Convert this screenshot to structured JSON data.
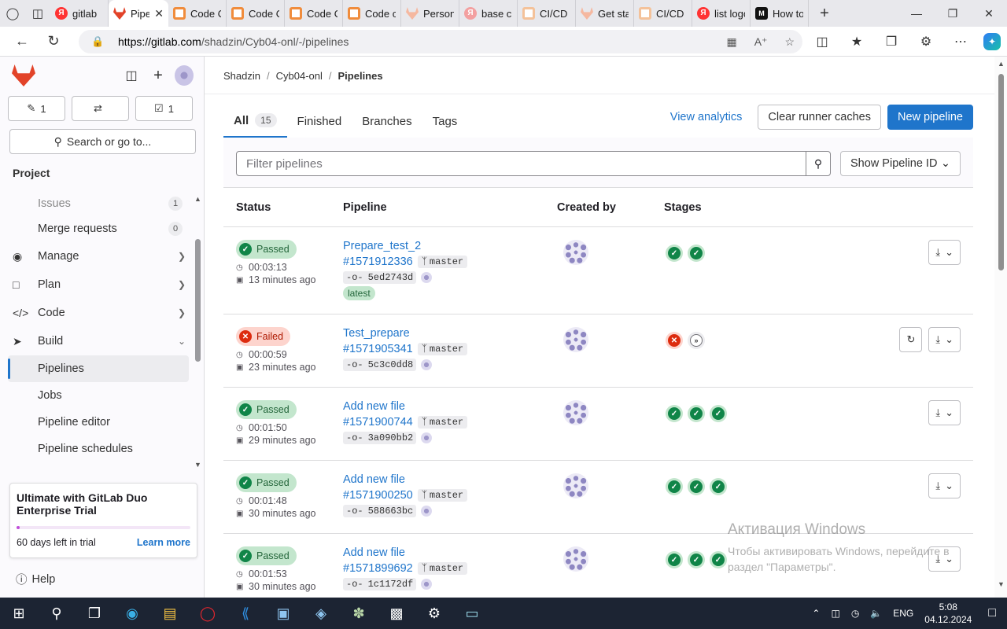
{
  "browser": {
    "tabs": [
      {
        "title": "gitlab",
        "icon": "yandex-icon"
      },
      {
        "title": "Pipelines",
        "icon": "gitlab-icon",
        "active": true
      },
      {
        "title": "Code O",
        "icon": "coursera-icon"
      },
      {
        "title": "Code O",
        "icon": "coursera-icon"
      },
      {
        "title": "Code O",
        "icon": "coursera-icon"
      },
      {
        "title": "Code co",
        "icon": "coursera-icon"
      },
      {
        "title": "Persona",
        "icon": "gitlab-icon"
      },
      {
        "title": "base ci",
        "icon": "yandex-icon"
      },
      {
        "title": "CI/CD Y",
        "icon": "coursera-icon"
      },
      {
        "title": "Get star",
        "icon": "gitlab-icon"
      },
      {
        "title": "CI/CD Y",
        "icon": "coursera-icon"
      },
      {
        "title": "list logo",
        "icon": "yandex-icon"
      },
      {
        "title": "How to",
        "icon": "medium-icon"
      }
    ],
    "url_host": "https://gitlab.com",
    "url_path": "/shadzin/Cyb04-onl/-/pipelines"
  },
  "sidebar": {
    "counts": {
      "issues": "1",
      "merge_requests": "",
      "todos": "1"
    },
    "search_label": "Search or go to...",
    "section_title": "Project",
    "items": [
      {
        "label": "Issues",
        "badge": "1"
      },
      {
        "label": "Merge requests",
        "badge": "0"
      },
      {
        "label": "Manage"
      },
      {
        "label": "Plan"
      },
      {
        "label": "Code"
      },
      {
        "label": "Build"
      },
      {
        "label": "Pipelines"
      },
      {
        "label": "Jobs"
      },
      {
        "label": "Pipeline editor"
      },
      {
        "label": "Pipeline schedules"
      }
    ],
    "trial": {
      "title": "Ultimate with GitLab Duo Enterprise Trial",
      "days_left": "60 days left in trial",
      "progress": 0.02,
      "learn_more": "Learn more"
    },
    "help_label": "Help"
  },
  "breadcrumb": [
    "Shadzin",
    "Cyb04-onl",
    "Pipelines"
  ],
  "tabs": [
    {
      "label": "All",
      "count": "15"
    },
    {
      "label": "Finished"
    },
    {
      "label": "Branches"
    },
    {
      "label": "Tags"
    }
  ],
  "actions": {
    "analytics": "View analytics",
    "clear_caches": "Clear runner caches",
    "new_pipeline": "New pipeline"
  },
  "filter": {
    "placeholder": "Filter pipelines",
    "show_id": "Show Pipeline ID"
  },
  "columns": [
    "Status",
    "Pipeline",
    "Created by",
    "Stages"
  ],
  "pipelines": [
    {
      "status": "Passed",
      "duration": "00:03:13",
      "ago": "13 minutes ago",
      "name": "Prepare_test_2",
      "id": "#1571912336",
      "branch": "master",
      "sha": "5ed2743d",
      "latest": "latest",
      "stages": [
        "success",
        "success"
      ]
    },
    {
      "status": "Failed",
      "duration": "00:00:59",
      "ago": "23 minutes ago",
      "name": "Test_prepare",
      "id": "#1571905341",
      "branch": "master",
      "sha": "5c3c0dd8",
      "stages": [
        "failed",
        "skipped"
      ]
    },
    {
      "status": "Passed",
      "duration": "00:01:50",
      "ago": "29 minutes ago",
      "name": "Add new file",
      "id": "#1571900744",
      "branch": "master",
      "sha": "3a090bb2",
      "stages": [
        "success",
        "success",
        "success"
      ]
    },
    {
      "status": "Passed",
      "duration": "00:01:48",
      "ago": "30 minutes ago",
      "name": "Add new file",
      "id": "#1571900250",
      "branch": "master",
      "sha": "588663bc",
      "stages": [
        "success",
        "success",
        "success"
      ]
    },
    {
      "status": "Passed",
      "duration": "00:01:53",
      "ago": "30 minutes ago",
      "name": "Add new file",
      "id": "#1571899692",
      "branch": "master",
      "sha": "1c1172df",
      "stages": [
        "success",
        "success",
        "success"
      ]
    }
  ],
  "watermark": {
    "line1": "Активация Windows",
    "line2": "Чтобы активировать Windows, перейдите в",
    "line3": "раздел \"Параметры\"."
  },
  "taskbar": {
    "lang": "ENG",
    "time": "5:08",
    "date": "04.12.2024"
  }
}
